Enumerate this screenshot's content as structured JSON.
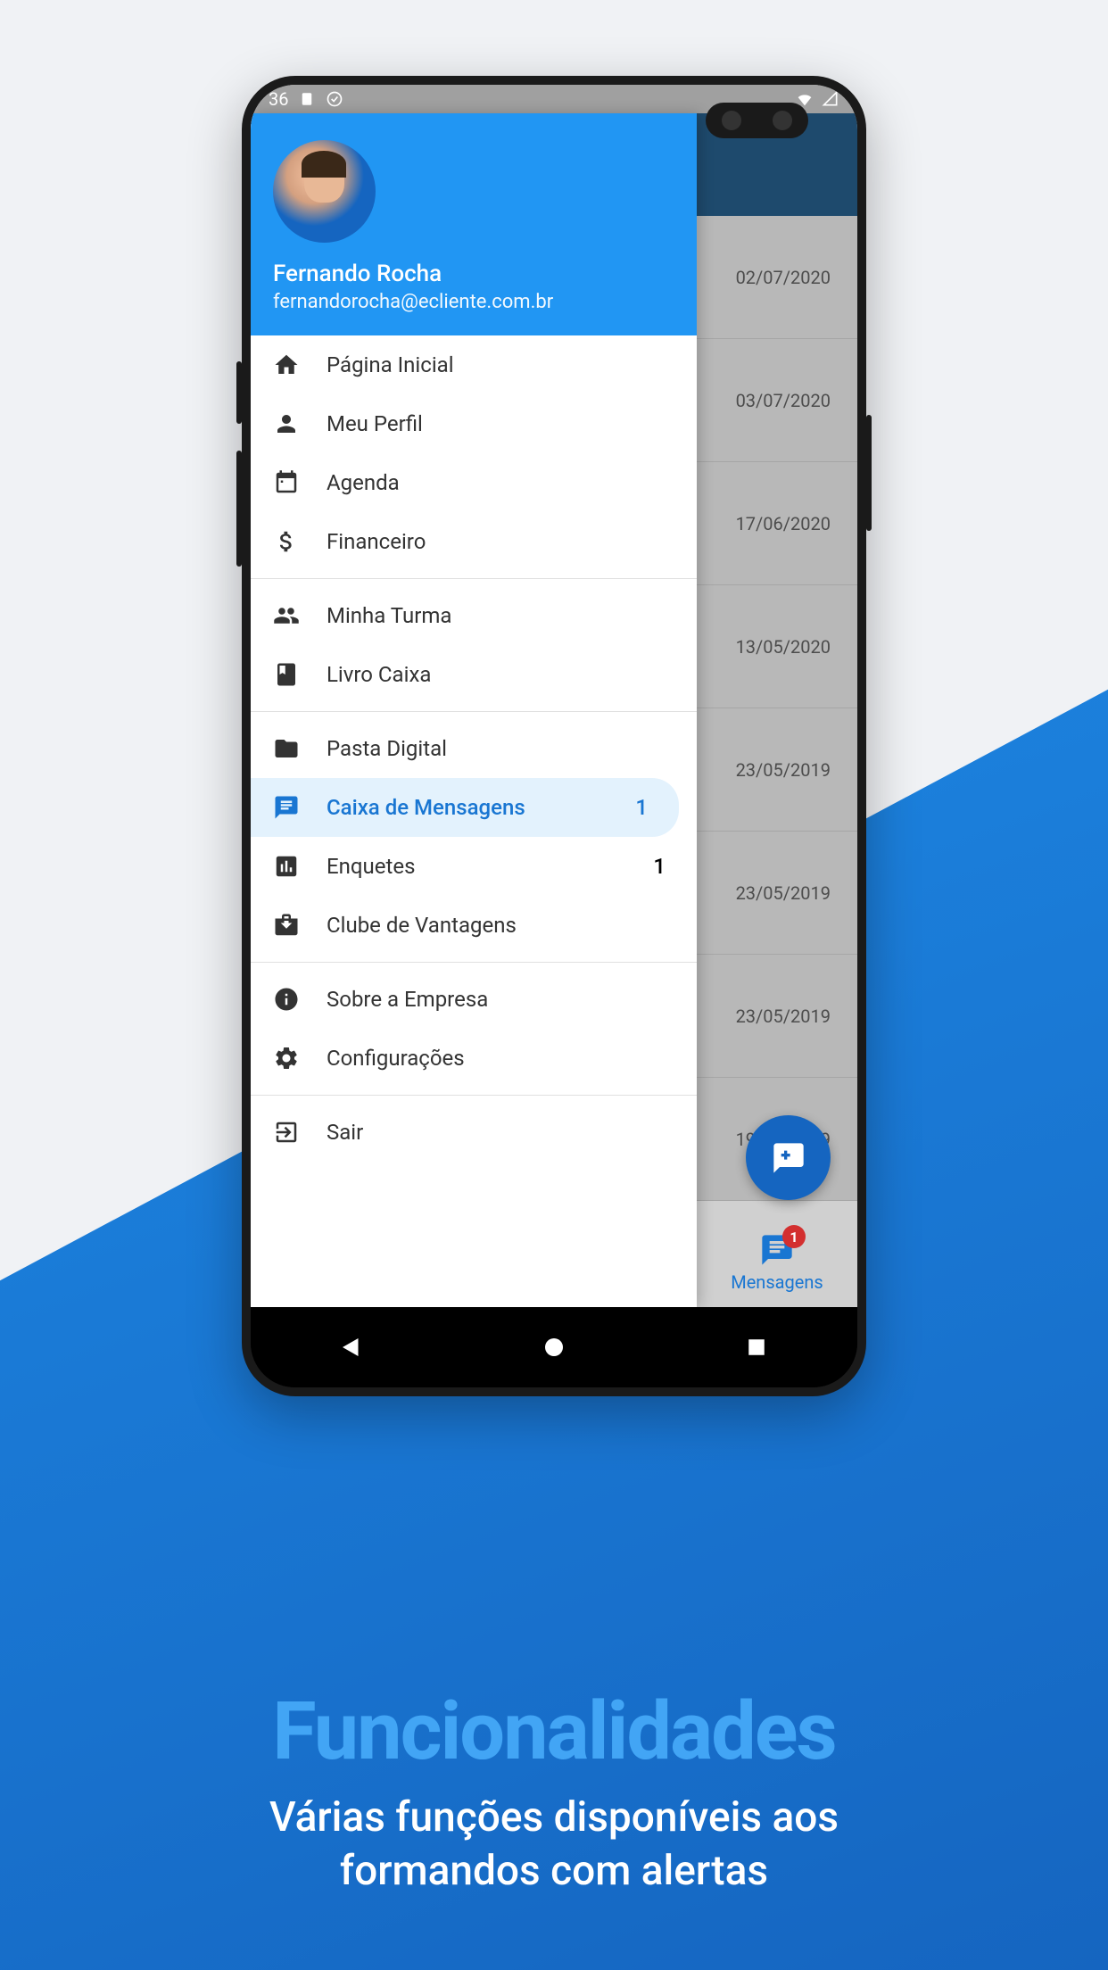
{
  "status": {
    "time": "36"
  },
  "user": {
    "name": "Fernando Rocha",
    "email": "fernandorocha@ecliente.com.br"
  },
  "menu": {
    "items": [
      {
        "label": "Página Inicial",
        "icon": "home"
      },
      {
        "label": "Meu Perfil",
        "icon": "person"
      },
      {
        "label": "Agenda",
        "icon": "calendar"
      },
      {
        "label": "Financeiro",
        "icon": "dollar"
      },
      {
        "label": "Minha Turma",
        "icon": "group"
      },
      {
        "label": "Livro Caixa",
        "icon": "book"
      },
      {
        "label": "Pasta Digital",
        "icon": "folder"
      },
      {
        "label": "Caixa de Mensagens",
        "icon": "chat",
        "badge": "1",
        "active": true
      },
      {
        "label": "Enquetes",
        "icon": "poll",
        "badge": "1"
      },
      {
        "label": "Clube de Vantagens",
        "icon": "shop"
      },
      {
        "label": "Sobre a Empresa",
        "icon": "info"
      },
      {
        "label": "Configurações",
        "icon": "settings"
      },
      {
        "label": "Sair",
        "icon": "exit"
      }
    ]
  },
  "messages": [
    {
      "date": "02/07/2020"
    },
    {
      "date": "03/07/2020"
    },
    {
      "date": "17/06/2020"
    },
    {
      "date": "13/05/2020"
    },
    {
      "date": "23/05/2019"
    },
    {
      "date": "23/05/2019"
    },
    {
      "date": "23/05/2019"
    },
    {
      "date": "19/05/2019"
    }
  ],
  "bottom_tab": {
    "label": "Mensagens",
    "badge": "1"
  },
  "marketing": {
    "title": "Funcionalidades",
    "subtitle_line1": "Várias funções disponíveis aos",
    "subtitle_line2": "formandos com alertas"
  }
}
